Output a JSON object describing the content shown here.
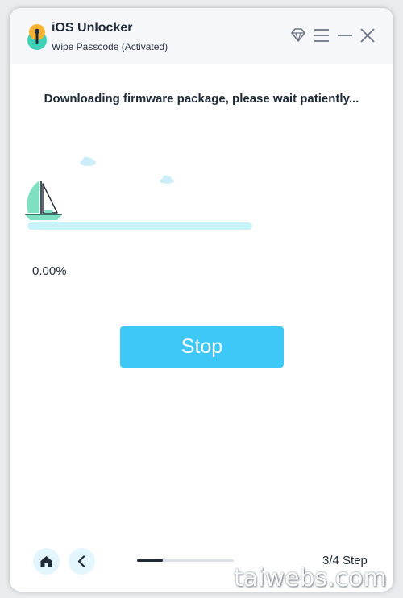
{
  "app": {
    "title": "iOS Unlocker",
    "subtitle": "Wipe Passcode  (Activated)"
  },
  "controls": {
    "icons": [
      "diamond-icon",
      "menu-icon",
      "minimize-icon",
      "close-icon"
    ]
  },
  "main": {
    "heading": "Downloading firmware package, please wait patiently...",
    "progress_fraction": 0.0,
    "progress_text": "0.00%",
    "stop_label": "Stop"
  },
  "footer": {
    "step_label": "3/4 Step",
    "step_current": 3,
    "step_total": 4,
    "step_progress_fraction": 0.27
  },
  "watermark": "taiwebs.com",
  "colors": {
    "accent": "#3ec8f7",
    "track": "#c9f3fb",
    "text": "#1f2a37",
    "boat_sail": "#7ee0c0"
  }
}
